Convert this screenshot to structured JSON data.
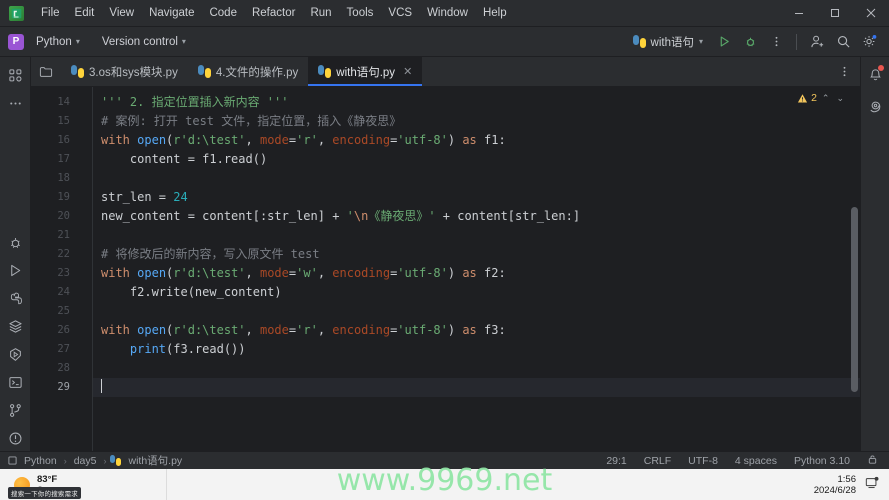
{
  "titlebar": {
    "logo": "pycharm-logo",
    "menus": [
      "File",
      "Edit",
      "View",
      "Navigate",
      "Code",
      "Refactor",
      "Run",
      "Tools",
      "VCS",
      "Window",
      "Help"
    ],
    "window_controls": [
      "minimize",
      "maximize",
      "close"
    ]
  },
  "toolbar": {
    "project_badge": "P",
    "project_name": "Python",
    "vcs_label": "Version control",
    "run_config": "with语句",
    "run_icon": "run-icon",
    "debug_icon": "debug-icon",
    "more_icon": "more-options-icon",
    "account_icon": "add-account-icon",
    "search_icon": "search-icon",
    "settings_icon": "settings-icon"
  },
  "tabs": [
    {
      "label": "3.os和sys模块.py",
      "active": false,
      "closable": false
    },
    {
      "label": "4.文件的操作.py",
      "active": false,
      "closable": false
    },
    {
      "label": "with语句.py",
      "active": true,
      "closable": true,
      "close_label": "✕"
    }
  ],
  "tabbar": {
    "more_icon": "tab-more-icon",
    "file_icon": "project-files-icon"
  },
  "left_rail": [
    {
      "name": "project-icon"
    },
    {
      "name": "more-tool-windows-icon"
    },
    {
      "name": "debug-icon"
    },
    {
      "name": "run-icon"
    },
    {
      "name": "python-packages-icon"
    },
    {
      "name": "services-icon"
    },
    {
      "name": "python-console-icon"
    },
    {
      "name": "terminal-icon"
    },
    {
      "name": "version-control-icon"
    },
    {
      "name": "problems-icon"
    }
  ],
  "right_rail": [
    {
      "name": "notifications-icon",
      "badge": true
    },
    {
      "name": "ai-assistant-icon",
      "badge": false
    }
  ],
  "inspection": {
    "warning_icon": "warning-triangle-icon",
    "warning_count": "2",
    "prev_icon": "⌃",
    "next_icon": "⌄"
  },
  "editor": {
    "first_line": 14,
    "current_line": 29,
    "lines": [
      {
        "n": 14,
        "html": "<span class='c-str'>''' 2. 指定位置插入新内容 '''</span>"
      },
      {
        "n": 15,
        "html": "<span class='c-com'># 案例: 打开 test 文件，指定位置，插入《静夜思》</span>"
      },
      {
        "n": 16,
        "html": "<span class='c-kw'>with</span> <span class='c-fn'>open</span>(<span class='c-str'>r'd:\\test'</span>, <span class='c-par'>mode</span>=<span class='c-str'>'r'</span>, <span class='c-par'>encoding</span>=<span class='c-str'>'utf-8'</span>) <span class='c-kw'>as</span> f1:"
      },
      {
        "n": 17,
        "html": "    content = f1.read()"
      },
      {
        "n": 18,
        "html": ""
      },
      {
        "n": 19,
        "html": "str_len = <span class='c-num'>24</span>"
      },
      {
        "n": 20,
        "html": "new_content = content[:str_len] + <span class='c-str'>'</span><span class='c-esc'>\\n</span><span class='c-str'>《静夜思》'</span> + content[str_len:]"
      },
      {
        "n": 21,
        "html": ""
      },
      {
        "n": 22,
        "html": "<span class='c-com'># 将修改后的新内容，写入原文件 test</span>"
      },
      {
        "n": 23,
        "html": "<span class='c-kw'>with</span> <span class='c-fn'>open</span>(<span class='c-str'>r'd:\\test'</span>, <span class='c-par'>mode</span>=<span class='c-str'>'w'</span>, <span class='c-par'>encoding</span>=<span class='c-str'>'utf-8'</span>) <span class='c-kw'>as</span> f2:"
      },
      {
        "n": 24,
        "html": "    f2.write(new_content)"
      },
      {
        "n": 25,
        "html": ""
      },
      {
        "n": 26,
        "html": "<span class='c-kw'>with</span> <span class='c-fn'>open</span>(<span class='c-str'>r'd:\\test'</span>, <span class='c-par'>mode</span>=<span class='c-str'>'r'</span>, <span class='c-par'>encoding</span>=<span class='c-str'>'utf-8'</span>) <span class='c-kw'>as</span> f3:"
      },
      {
        "n": 27,
        "html": "    <span class='c-fn'>print</span>(f3.read())"
      },
      {
        "n": 28,
        "html": ""
      },
      {
        "n": 29,
        "html": ""
      }
    ]
  },
  "statusbar": {
    "breadcrumbs": [
      "Python",
      "day5",
      "with语句.py"
    ],
    "separator": "›",
    "caret_position": "29:1",
    "line_separator": "CRLF",
    "encoding": "UTF-8",
    "indent": "4 spaces",
    "interpreter": "Python 3.10",
    "lock_icon": "read-only-toggle-icon"
  },
  "taskbar": {
    "weather_temp": "83°F",
    "weather_condition": "Sunny",
    "tooltip": "搜索一下你的搜索需求",
    "clock_time": "1:56",
    "clock_date": "2024/6/28",
    "tray_icon": "notification-center-icon"
  },
  "watermark": {
    "text": "www.9969.net",
    "color": "#92e6a7"
  }
}
